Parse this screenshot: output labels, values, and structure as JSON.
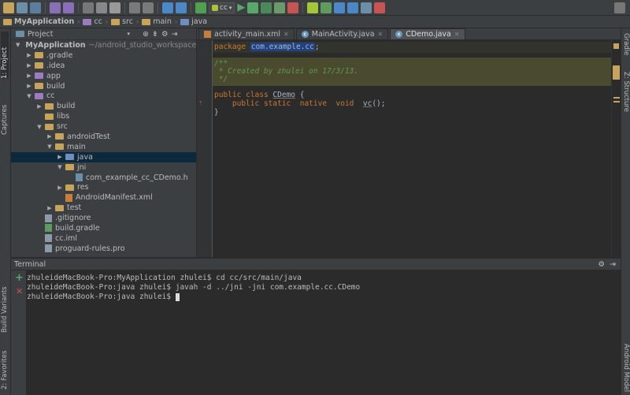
{
  "toolbar": {
    "run_config": "cc"
  },
  "breadcrumb": [
    {
      "label": "MyApplication",
      "bold": true
    },
    {
      "label": "cc"
    },
    {
      "label": "src"
    },
    {
      "label": "main"
    },
    {
      "label": "java"
    }
  ],
  "left_tabs": {
    "project": "1: Project",
    "captures": "Captures",
    "build_variants": "Build Variants",
    "favorites": "2: Favorites"
  },
  "right_tabs": {
    "gradle": "Gradle",
    "structure": "Z: Structure",
    "android_model": "Android Model"
  },
  "project": {
    "view_mode": "Project",
    "tree": [
      {
        "label": "MyApplication",
        "extra": "~/android_studio_workspace/de",
        "depth": 0,
        "arrow": "down",
        "icon": "module",
        "bold": true
      },
      {
        "label": ".gradle",
        "depth": 1,
        "arrow": "right",
        "icon": "folder"
      },
      {
        "label": ".idea",
        "depth": 1,
        "arrow": "right",
        "icon": "folder"
      },
      {
        "label": "app",
        "depth": 1,
        "arrow": "right",
        "icon": "module"
      },
      {
        "label": "build",
        "depth": 1,
        "arrow": "right",
        "icon": "folder"
      },
      {
        "label": "cc",
        "depth": 1,
        "arrow": "down",
        "icon": "module"
      },
      {
        "label": "build",
        "depth": 2,
        "arrow": "right",
        "icon": "folder"
      },
      {
        "label": "libs",
        "depth": 2,
        "arrow": "",
        "icon": "folder"
      },
      {
        "label": "src",
        "depth": 2,
        "arrow": "down",
        "icon": "folder"
      },
      {
        "label": "androidTest",
        "depth": 3,
        "arrow": "right",
        "icon": "folder"
      },
      {
        "label": "main",
        "depth": 3,
        "arrow": "down",
        "icon": "folder"
      },
      {
        "label": "java",
        "depth": 4,
        "arrow": "right",
        "icon": "src",
        "selected": true
      },
      {
        "label": "jni",
        "depth": 4,
        "arrow": "down",
        "icon": "folder"
      },
      {
        "label": "com_example_cc_CDemo.h",
        "depth": 5,
        "arrow": "",
        "icon": "h"
      },
      {
        "label": "res",
        "depth": 4,
        "arrow": "right",
        "icon": "folder"
      },
      {
        "label": "AndroidManifest.xml",
        "depth": 4,
        "arrow": "",
        "icon": "xml"
      },
      {
        "label": "test",
        "depth": 3,
        "arrow": "right",
        "icon": "folder"
      },
      {
        "label": ".gitignore",
        "depth": 2,
        "arrow": "",
        "icon": "file"
      },
      {
        "label": "build.gradle",
        "depth": 2,
        "arrow": "",
        "icon": "gradle"
      },
      {
        "label": "cc.iml",
        "depth": 2,
        "arrow": "",
        "icon": "file"
      },
      {
        "label": "proguard-rules.pro",
        "depth": 2,
        "arrow": "",
        "icon": "file"
      }
    ]
  },
  "editor": {
    "tabs": [
      {
        "label": "activity_main.xml",
        "icon": "xml",
        "active": false
      },
      {
        "label": "MainActivity.java",
        "icon": "class",
        "active": false
      },
      {
        "label": "CDemo.java",
        "icon": "class",
        "active": true
      }
    ],
    "code": {
      "line1_kw": "package",
      "line1_pkg": "com.example.cc",
      "line1_end": ";",
      "line3": "/**",
      "line4": " * Created by zhulei on 17/3/13.",
      "line5": " */",
      "line7_kw1": "public",
      "line7_kw2": "class",
      "line7_name": "CDemo",
      "line7_end": " {",
      "line8_kw1": "public",
      "line8_kw2": "static",
      "line8_kw3": "native",
      "line8_kw4": "void",
      "line8_name": "vc",
      "line8_end": "();",
      "line9": "}"
    }
  },
  "terminal": {
    "title": "Terminal",
    "lines": [
      "zhuleideMacBook-Pro:MyApplication zhulei$ cd cc/src/main/java",
      "zhuleideMacBook-Pro:java zhulei$ javah -d ../jni -jni com.example.cc.CDemo",
      "zhuleideMacBook-Pro:java zhulei$ "
    ]
  }
}
